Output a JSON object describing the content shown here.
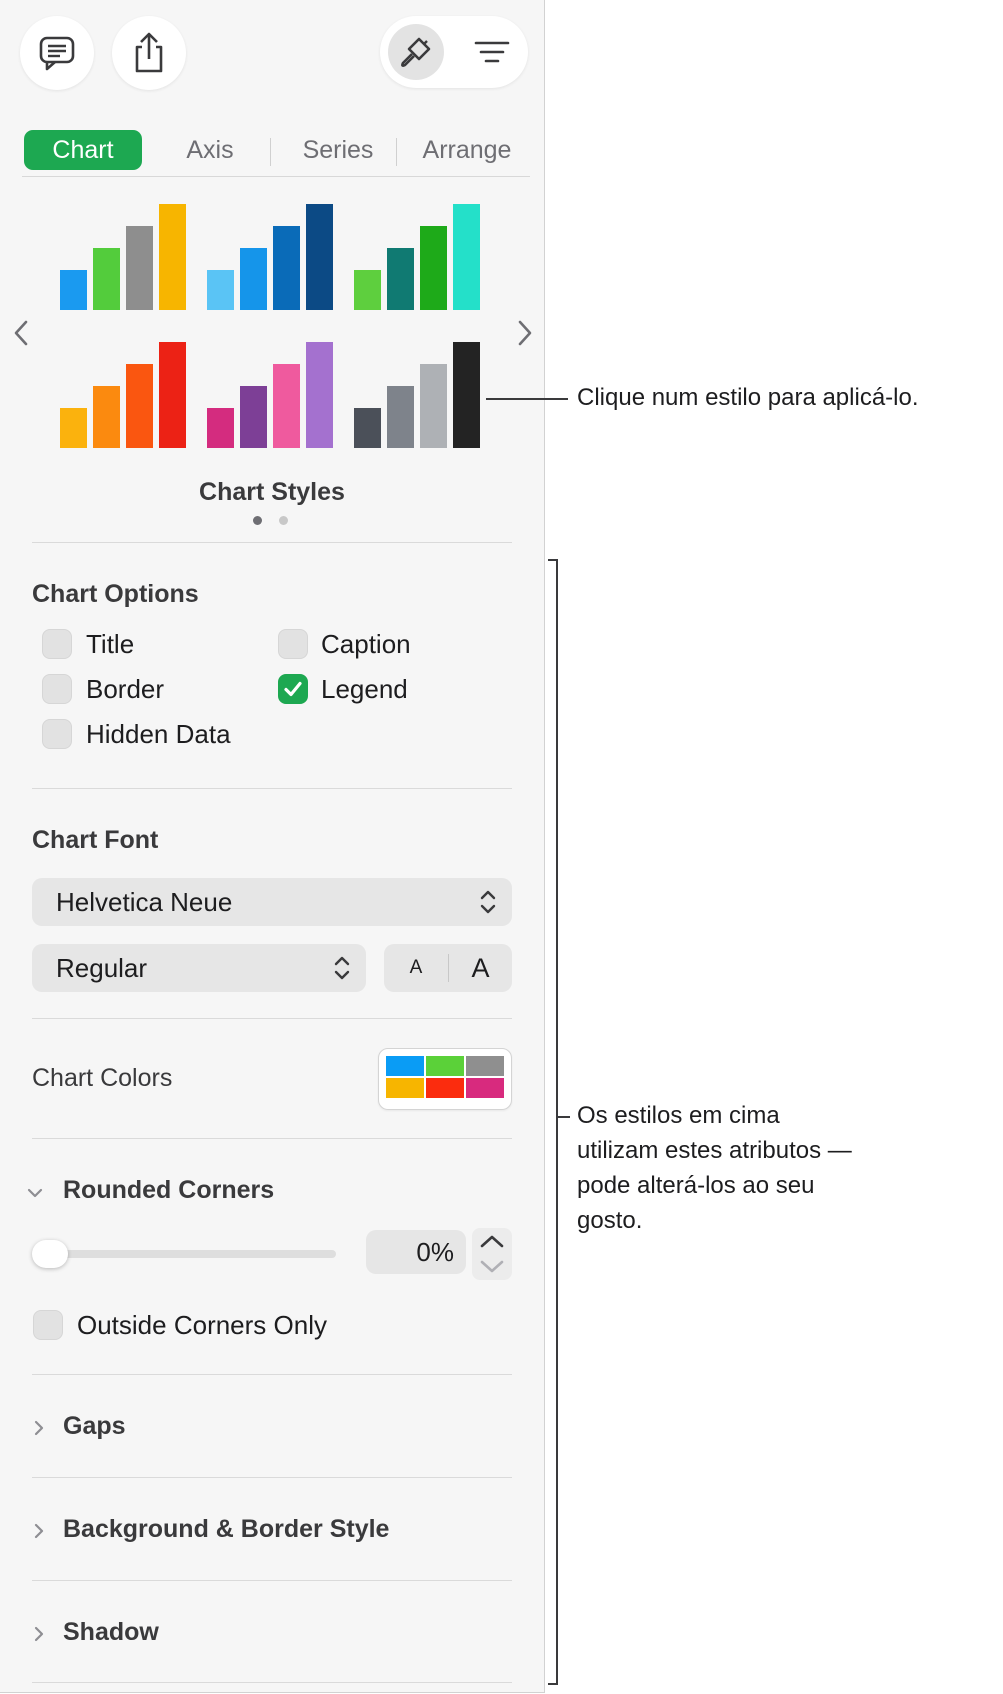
{
  "toolbar": {
    "comment_icon": "comment-icon",
    "share_icon": "share-icon",
    "format_icon": "paintbrush-icon",
    "organize_icon": "organize-icon"
  },
  "tabs": [
    {
      "label": "Chart",
      "active": true
    },
    {
      "label": "Axis",
      "active": false
    },
    {
      "label": "Series",
      "active": false
    },
    {
      "label": "Arrange",
      "active": false
    }
  ],
  "chart_styles": {
    "label": "Chart Styles",
    "page": 1,
    "page_count": 2,
    "styles": [
      {
        "colors": [
          "#1a9af0",
          "#53cc3c",
          "#8e8e8e",
          "#f7b500"
        ]
      },
      {
        "colors": [
          "#5ac4f5",
          "#1595ea",
          "#0a6bb8",
          "#0c4a85"
        ]
      },
      {
        "colors": [
          "#5ecf3e",
          "#107a72",
          "#1eaa19",
          "#24e0c9"
        ]
      },
      {
        "colors": [
          "#fbb20d",
          "#fb8a0f",
          "#fa5610",
          "#ec2215"
        ]
      },
      {
        "colors": [
          "#d42c7f",
          "#7d3f96",
          "#ef5a9e",
          "#a471cf"
        ]
      },
      {
        "colors": [
          "#4b5059",
          "#7e838b",
          "#aeb1b5",
          "#232323"
        ]
      }
    ]
  },
  "chart_options": {
    "title": "Chart Options",
    "items": [
      {
        "label": "Title",
        "checked": false
      },
      {
        "label": "Caption",
        "checked": false
      },
      {
        "label": "Border",
        "checked": false
      },
      {
        "label": "Legend",
        "checked": true
      },
      {
        "label": "Hidden Data",
        "checked": false
      }
    ]
  },
  "chart_font": {
    "title": "Chart Font",
    "family": "Helvetica Neue",
    "typeface": "Regular",
    "decrease_label": "A",
    "increase_label": "A"
  },
  "chart_colors": {
    "label": "Chart Colors",
    "swatches": [
      "#0a9cf5",
      "#5bd139",
      "#8f8f8f",
      "#f7b500",
      "#fb2c0e",
      "#d82a7e"
    ]
  },
  "rounded_corners": {
    "title": "Rounded Corners",
    "value": "0%",
    "slider_fraction": 0,
    "outside_corners_label": "Outside Corners Only",
    "outside_corners_checked": false
  },
  "sections": [
    {
      "label": "Gaps"
    },
    {
      "label": "Background & Border Style"
    },
    {
      "label": "Shadow"
    }
  ],
  "callouts": {
    "styles_note": "Clique num estilo para aplicá-lo.",
    "attributes_note_lines": [
      "Os estilos em cima",
      "utilizam estes atributos —",
      "pode alterá-los ao seu",
      "gosto."
    ]
  },
  "colors": {
    "accent_green": "#1da851",
    "panel_bg": "#f6f6f6"
  }
}
